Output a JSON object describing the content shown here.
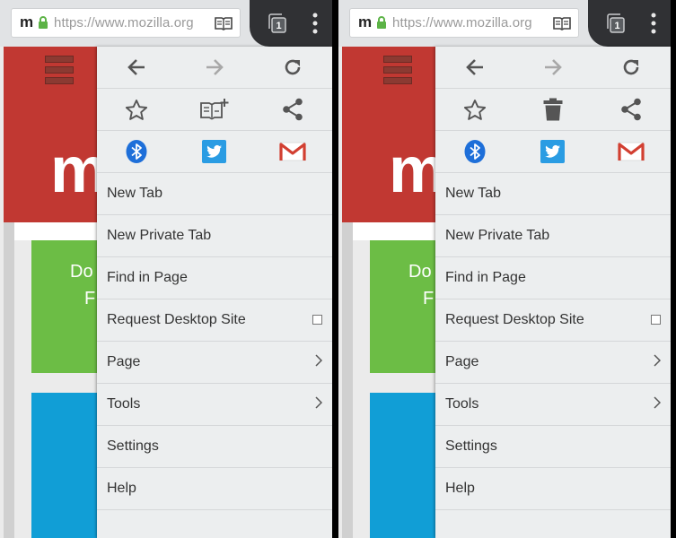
{
  "toolbar": {
    "favicon_letter": "m",
    "url_text": "https://www.mozilla.org",
    "tab_count": "1",
    "lock_color": "#5cb346",
    "icons": [
      "lock-icon",
      "reader-mode-icon",
      "tabs-counter-icon",
      "overflow-menu-icon"
    ]
  },
  "page": {
    "big_letter": "m",
    "green_tile_text": [
      "Do",
      "F"
    ]
  },
  "menu_left": {
    "icon_rows": [
      [
        "back-arrow-icon",
        "forward-arrow-icon",
        "reload-icon"
      ],
      [
        "star-bookmark-icon",
        "add-to-reading-list-icon",
        "share-icon"
      ],
      [
        "bluetooth-icon",
        "twitter-icon",
        "gmail-icon"
      ]
    ],
    "items": [
      {
        "label": "New Tab"
      },
      {
        "label": "New Private Tab"
      },
      {
        "label": "Find in Page"
      },
      {
        "label": "Request Desktop Site"
      },
      {
        "label": "Page"
      },
      {
        "label": "Tools"
      },
      {
        "label": "Settings"
      },
      {
        "label": "Help"
      }
    ]
  },
  "menu_right": {
    "icon_rows": [
      [
        "back-arrow-icon",
        "forward-arrow-icon",
        "reload-icon"
      ],
      [
        "star-bookmark-icon",
        "trash-icon",
        "share-icon"
      ],
      [
        "bluetooth-icon",
        "twitter-icon",
        "gmail-icon"
      ]
    ],
    "items": [
      {
        "label": "New Tab"
      },
      {
        "label": "New Private Tab"
      },
      {
        "label": "Find in Page"
      },
      {
        "label": "Request Desktop Site"
      },
      {
        "label": "Page"
      },
      {
        "label": "Tools"
      },
      {
        "label": "Settings"
      },
      {
        "label": "Help"
      }
    ]
  },
  "colors": {
    "brand_red": "#c13832",
    "tile_green": "#6cbd45",
    "tile_blue": "#119ed6",
    "bluetooth_blue": "#1e6fd9",
    "twitter_blue": "#2a9ce3",
    "gmail_red": "#d23f31",
    "menu_bg": "#eceeef"
  }
}
